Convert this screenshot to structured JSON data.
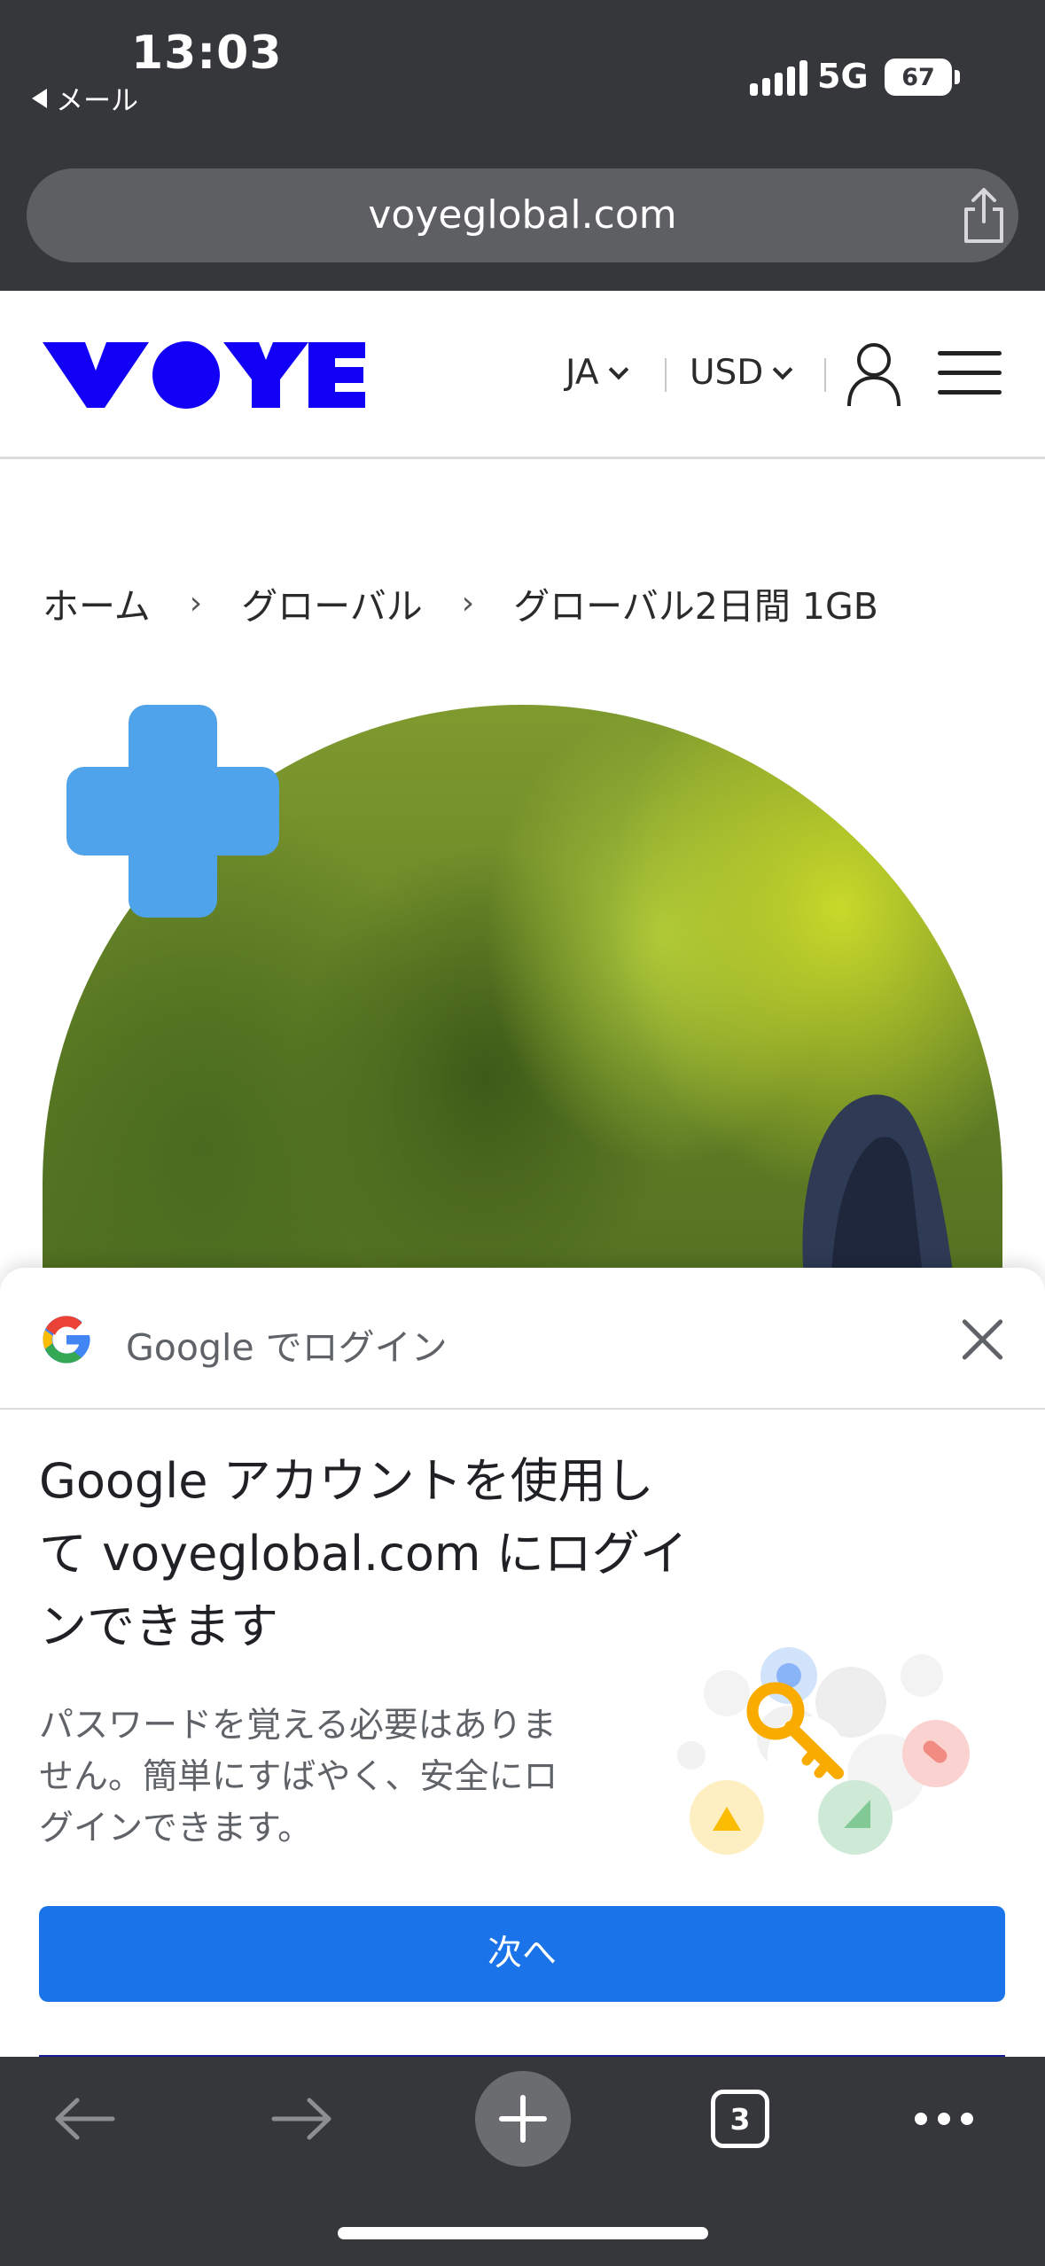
{
  "status_bar": {
    "time": "13:03",
    "back_app": "メール",
    "network": "5G",
    "battery": "67"
  },
  "browser": {
    "url": "voyeglobal.com",
    "share_icon": "share-icon"
  },
  "site_header": {
    "logo": "VOYE",
    "language": "JA",
    "currency": "USD",
    "brand_color": "#1100f5",
    "account_icon": "user-icon",
    "menu_icon": "hamburger-menu-icon"
  },
  "breadcrumb": {
    "items": [
      "ホーム",
      "グローバル",
      "グローバル2日間 1GB"
    ]
  },
  "product": {
    "badge_icon": "plus-icon",
    "badge_color": "#4fa3ea"
  },
  "google_signin": {
    "title": "Google でログイン",
    "headline_lines": [
      "Google アカウントを使用し",
      "て voyeglobal.com にログイ",
      "ンできます"
    ],
    "description_lines": [
      "パスワードを覚える必要はありま",
      "せん。簡単にすばやく、安全にロ",
      "グインできます。"
    ],
    "next_button": "次へ",
    "button_color": "#1a73e8"
  },
  "bottom_toolbar": {
    "tab_count": "3",
    "back_icon": "arrow-left-icon",
    "forward_icon": "arrow-right-icon",
    "new_tab_icon": "plus-icon",
    "more_icon": "more-dots-icon"
  }
}
